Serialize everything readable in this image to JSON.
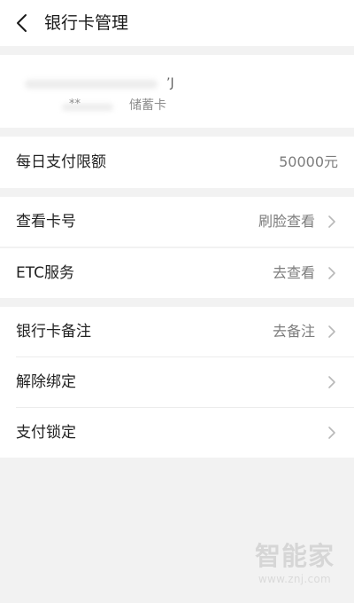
{
  "header": {
    "title": "银行卡管理",
    "back_icon": "chevron-left-icon"
  },
  "card": {
    "bank_name_tail": "’J",
    "masked_number": "**",
    "card_type": "储蓄卡"
  },
  "rows": [
    {
      "label": "每日支付限额",
      "value": "50000元",
      "icon": ""
    },
    {
      "label": "查看卡号",
      "value": "刷脸查看",
      "icon": "chevron-right-icon"
    },
    {
      "label": "ETC服务",
      "value": "去查看",
      "icon": "chevron-right-icon"
    },
    {
      "label": "银行卡备注",
      "value": "去备注",
      "icon": "chevron-right-icon"
    },
    {
      "label": "解除绑定",
      "value": "",
      "icon": "chevron-right-icon"
    },
    {
      "label": "支付锁定",
      "value": "",
      "icon": "chevron-right-icon"
    }
  ],
  "watermark": {
    "brand": "智能家",
    "url": "www.znj.com"
  },
  "colors": {
    "background": "#f2f2f2",
    "card_bg": "#ffffff",
    "text": "#222222",
    "secondary_text": "#7d7d7d",
    "chevron": "#b8b8b8"
  }
}
